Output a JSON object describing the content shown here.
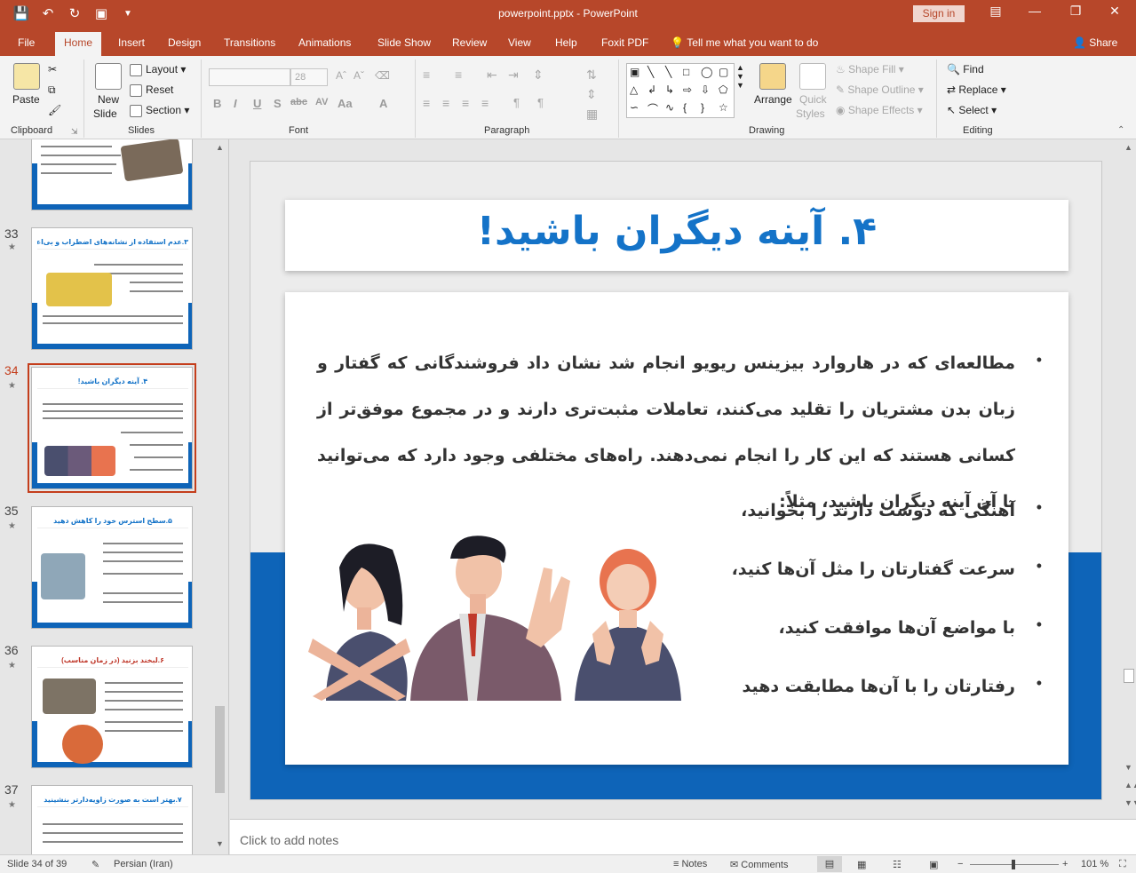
{
  "window": {
    "title": "powerpoint.pptx  -  PowerPoint",
    "signin": "Sign in"
  },
  "tabs": [
    "File",
    "Home",
    "Insert",
    "Design",
    "Transitions",
    "Animations",
    "Slide Show",
    "Review",
    "View",
    "Help",
    "Foxit PDF"
  ],
  "active_tab": "Home",
  "tellme": "Tell me what you want to do",
  "share": "Share",
  "ribbon": {
    "clipboard": {
      "label": "Clipboard",
      "paste": "Paste"
    },
    "slides": {
      "label": "Slides",
      "new_slide_1": "New",
      "new_slide_2": "Slide",
      "layout": "Layout",
      "reset": "Reset",
      "section": "Section"
    },
    "font": {
      "label": "Font",
      "size": "28"
    },
    "paragraph": {
      "label": "Paragraph"
    },
    "drawing": {
      "label": "Drawing",
      "arrange": "Arrange",
      "quick_1": "Quick",
      "quick_2": "Styles",
      "shape_fill": "Shape Fill",
      "shape_outline": "Shape Outline",
      "shape_effects": "Shape Effects"
    },
    "editing": {
      "label": "Editing",
      "find": "Find",
      "replace": "Replace",
      "select": "Select"
    }
  },
  "thumbnails": [
    {
      "num": "",
      "title": ""
    },
    {
      "num": "33",
      "title": "۳.عدم استفاده از نشانه‌های اضطراب و بی‌اعتمادی"
    },
    {
      "num": "34",
      "title": "۴. آینه دیگران باشید!"
    },
    {
      "num": "35",
      "title": "۵.سطح استرس خود را کاهش دهید"
    },
    {
      "num": "36",
      "title": "۶.لبخند بزنید (در زمان مناسب)"
    },
    {
      "num": "37",
      "title": "۷.بهتر است به صورت زاویه‌دارتر بنشینید"
    }
  ],
  "slide": {
    "title": "۴. آینه دیگران باشید!",
    "paragraph": "مطالعه‌ای که در هاروارد بیزینس ریویو  انجام شد نشان داد فروشندگانی که گفتار و زبان بدن مشتریان را تقلید می‌کنند، تعاملات مثبت‌تری دارند و در مجموع موفق‌تر از کسانی هستند که این کار را انجام نمی‌دهند. راه‌های مختلفی وجود دارد که می‌توانید با آن آینه دیگران باشید، مثلاً:",
    "bullets": [
      "آهنگی که دوست دارند را بخوانید،",
      "سرعت گفتارتان را مثل آن‌ها کنید،",
      "با مواضع آن‌ها موافقت کنید،",
      "رفتارتان را با آن‌ها مطابقت دهید"
    ],
    "colors": {
      "accent": "#1473c8",
      "band": "#0e64b8"
    }
  },
  "notes_placeholder": "Click to add notes",
  "status": {
    "slide_info": "Slide 34 of 39",
    "language": "Persian (Iran)",
    "notes": "Notes",
    "comments": "Comments",
    "zoom": "101 %"
  }
}
